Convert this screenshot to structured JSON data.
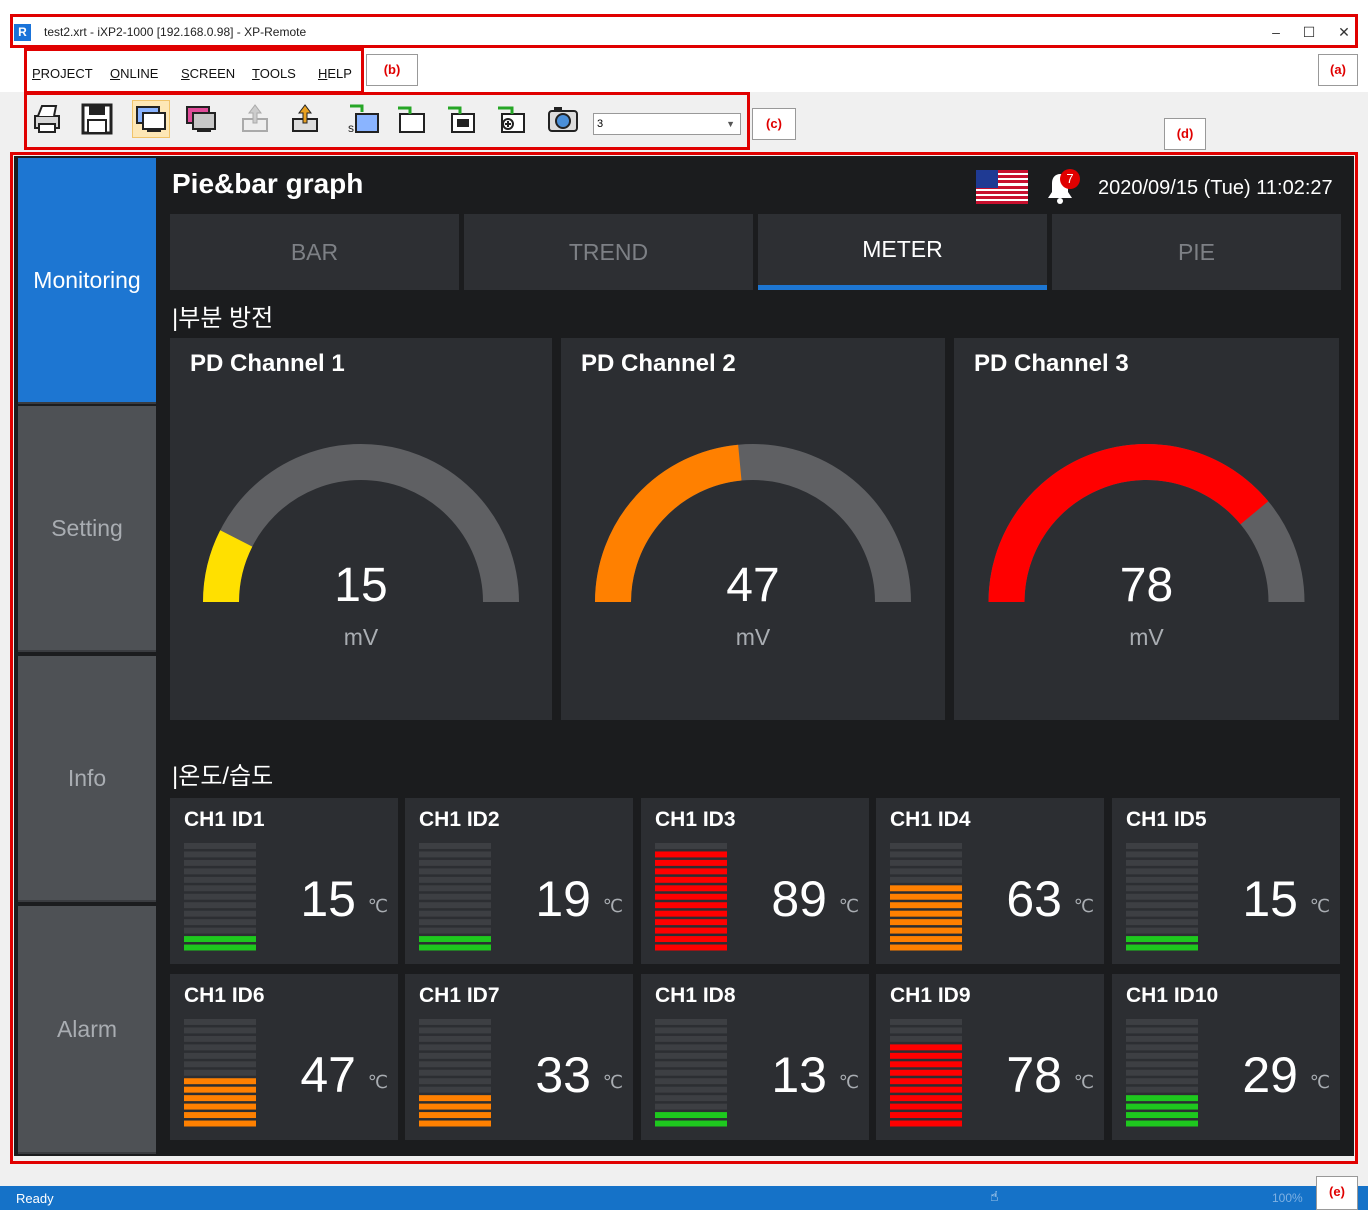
{
  "window": {
    "app_icon": "R",
    "title": "test2.xrt - iXP2-1000 [192.168.0.98] - XP-Remote",
    "minimize": "–",
    "maximize": "☐",
    "close": "✕"
  },
  "menu": [
    {
      "first": "P",
      "rest": "ROJECT"
    },
    {
      "first": "O",
      "rest": "NLINE"
    },
    {
      "first": "S",
      "rest": "CREEN"
    },
    {
      "first": "T",
      "rest": "OOLS"
    },
    {
      "first": "H",
      "rest": "ELP"
    }
  ],
  "toolbar": {
    "buttons": [
      "print-icon",
      "save-icon",
      "monitor-icon",
      "monitor-color-icon",
      "upload-disabled-icon",
      "upload-icon",
      "screen-step-icon",
      "screen-icon",
      "screen-record-icon",
      "screen-add-icon",
      "camera-icon"
    ],
    "screen_select": "3"
  },
  "annotations": {
    "a": "(a)",
    "b": "(b)",
    "c": "(c)",
    "d": "(d)",
    "e": "(e)"
  },
  "nav": [
    "Monitoring",
    "Setting",
    "Info",
    "Alarm"
  ],
  "header": {
    "title": "Pie&bar graph",
    "alarm_count": "7",
    "datetime": "2020/09/15 (Tue) 11:02:27"
  },
  "tabs": [
    "BAR",
    "TREND",
    "METER",
    "PIE"
  ],
  "active_tab": "METER",
  "section_pd": "|부분 방전",
  "section_temp": "|온도/습도",
  "gauges": [
    {
      "name": "PD Channel 1",
      "value": "15",
      "unit": "mV",
      "color": "#ffe000"
    },
    {
      "name": "PD Channel 2",
      "value": "47",
      "unit": "mV",
      "color": "#ff8000"
    },
    {
      "name": "PD Channel 3",
      "value": "78",
      "unit": "mV",
      "color": "#ff0000"
    }
  ],
  "sensors": [
    {
      "name": "CH1 ID1",
      "value": "15",
      "unit": "℃",
      "color": "#1ec81e"
    },
    {
      "name": "CH1 ID2",
      "value": "19",
      "unit": "℃",
      "color": "#1ec81e"
    },
    {
      "name": "CH1 ID3",
      "value": "89",
      "unit": "℃",
      "color": "#ff0000"
    },
    {
      "name": "CH1 ID4",
      "value": "63",
      "unit": "℃",
      "color": "#ff8000"
    },
    {
      "name": "CH1 ID5",
      "value": "15",
      "unit": "℃",
      "color": "#1ec81e"
    },
    {
      "name": "CH1 ID6",
      "value": "47",
      "unit": "℃",
      "color": "#ff8000"
    },
    {
      "name": "CH1 ID7",
      "value": "33",
      "unit": "℃",
      "color": "#ff8000"
    },
    {
      "name": "CH1 ID8",
      "value": "13",
      "unit": "℃",
      "color": "#1ec81e"
    },
    {
      "name": "CH1 ID9",
      "value": "78",
      "unit": "℃",
      "color": "#ff0000"
    },
    {
      "name": "CH1 ID10",
      "value": "29",
      "unit": "℃",
      "color": "#1ec81e"
    }
  ],
  "status": {
    "text": "Ready",
    "zoom": "100%"
  }
}
